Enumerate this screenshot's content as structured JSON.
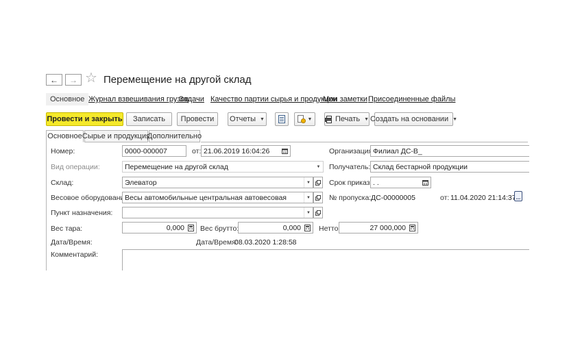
{
  "window": {
    "title": "Перемещение на другой склад"
  },
  "nav": {
    "back": "←",
    "forward": "→",
    "star": "☆",
    "links": [
      "Основное",
      "Журнал взвешивания грузов",
      "Задачи",
      "Качество партии сырья и продукции",
      "Мои заметки",
      "Присоединенные файлы"
    ]
  },
  "toolbar": {
    "post_close": "Провести и закрыть",
    "save": "Записать",
    "post": "Провести",
    "reports": "Отчеты",
    "print": "Печать",
    "create_based": "Создать на основании"
  },
  "tabs": [
    "Основное",
    "Сырье и продукция",
    "Дополнительно"
  ],
  "form": {
    "number_label": "Номер:",
    "number_value": "0000-000007",
    "date_from_label": "от:",
    "date_from_value": "21.06.2019 16:04:26",
    "org_label": "Организация:",
    "org_value": "Филиал ДС-В_",
    "optype_label": "Вид операции:",
    "optype_value": "Перемещение на другой склад",
    "recipient_label": "Получатель:",
    "recipient_value": "Склад бестарной продукции",
    "warehouse_label": "Склад:",
    "warehouse_value": "Элеватор",
    "order_term_label": "Срок приказа:",
    "order_term_value": " .  .",
    "scales_label": "Весовое оборудование:",
    "scales_value": "Весы автомобильные центральная автовесовая",
    "pass_label": "№ пропуска:",
    "pass_value": "ДС-00000005",
    "pass_date_label": "от:",
    "pass_date_value": "11.04.2020 21:14:37",
    "destination_label": "Пункт назначения:",
    "destination_value": "",
    "tare_label": "Вес тара:",
    "tare_value": "0,000",
    "gross_label": "Вес брутто:",
    "gross_value": "0,000",
    "net_label": "Нетто:",
    "net_value": "27 000,000",
    "datetime_label": "Дата/Время:",
    "datetime_label2": "Дата/Время:",
    "datetime_value": "08.03.2020 1:28:58",
    "comment_label": "Комментарий:",
    "comment_value": ""
  },
  "colors": {
    "primary_button": "#f5e92a",
    "border": "#a9a9a9"
  }
}
